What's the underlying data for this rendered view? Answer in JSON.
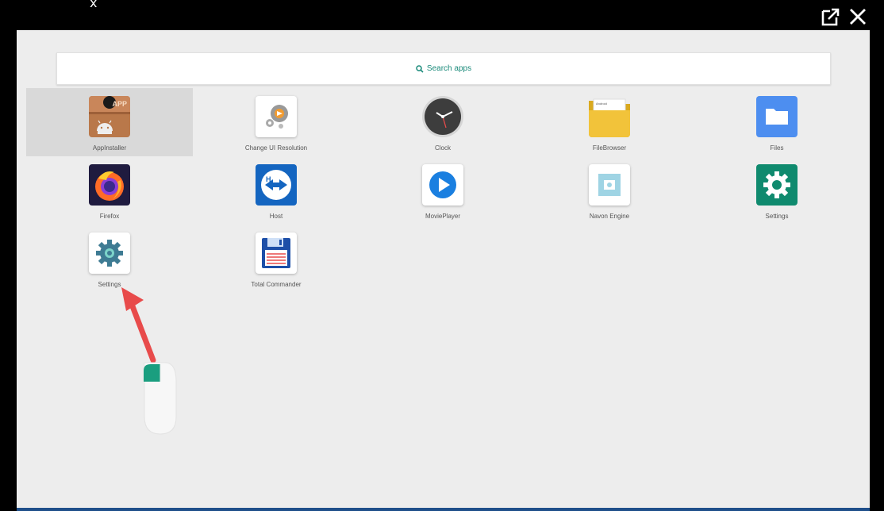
{
  "window": {
    "top_mark": "x",
    "popout_icon": "popout-icon",
    "close_icon": "close-icon"
  },
  "search": {
    "label": "Search apps",
    "icon": "search-icon"
  },
  "apps": [
    {
      "label": "AppInstaller",
      "icon": "appinstaller-icon"
    },
    {
      "label": "Change UI Resolution",
      "icon": "change-resolution-icon"
    },
    {
      "label": "Clock",
      "icon": "clock-icon"
    },
    {
      "label": "FileBrowser",
      "icon": "filebrowser-icon"
    },
    {
      "label": "Files",
      "icon": "files-icon"
    },
    {
      "label": "Firefox",
      "icon": "firefox-icon"
    },
    {
      "label": "Host",
      "icon": "host-icon"
    },
    {
      "label": "MoviePlayer",
      "icon": "movieplayer-icon"
    },
    {
      "label": "Navon Engine",
      "icon": "navon-engine-icon"
    },
    {
      "label": "Settings",
      "icon": "settings-green-icon"
    },
    {
      "label": "Settings",
      "icon": "settings-gear-icon"
    },
    {
      "label": "Total Commander",
      "icon": "total-commander-icon"
    }
  ],
  "appinstaller_badge": "APP",
  "filebrowser_badge": "Android",
  "colors": {
    "accent": "#1a8a7a",
    "arrow": "#e84b4b",
    "bottom_bar": "#1f4f8a"
  }
}
